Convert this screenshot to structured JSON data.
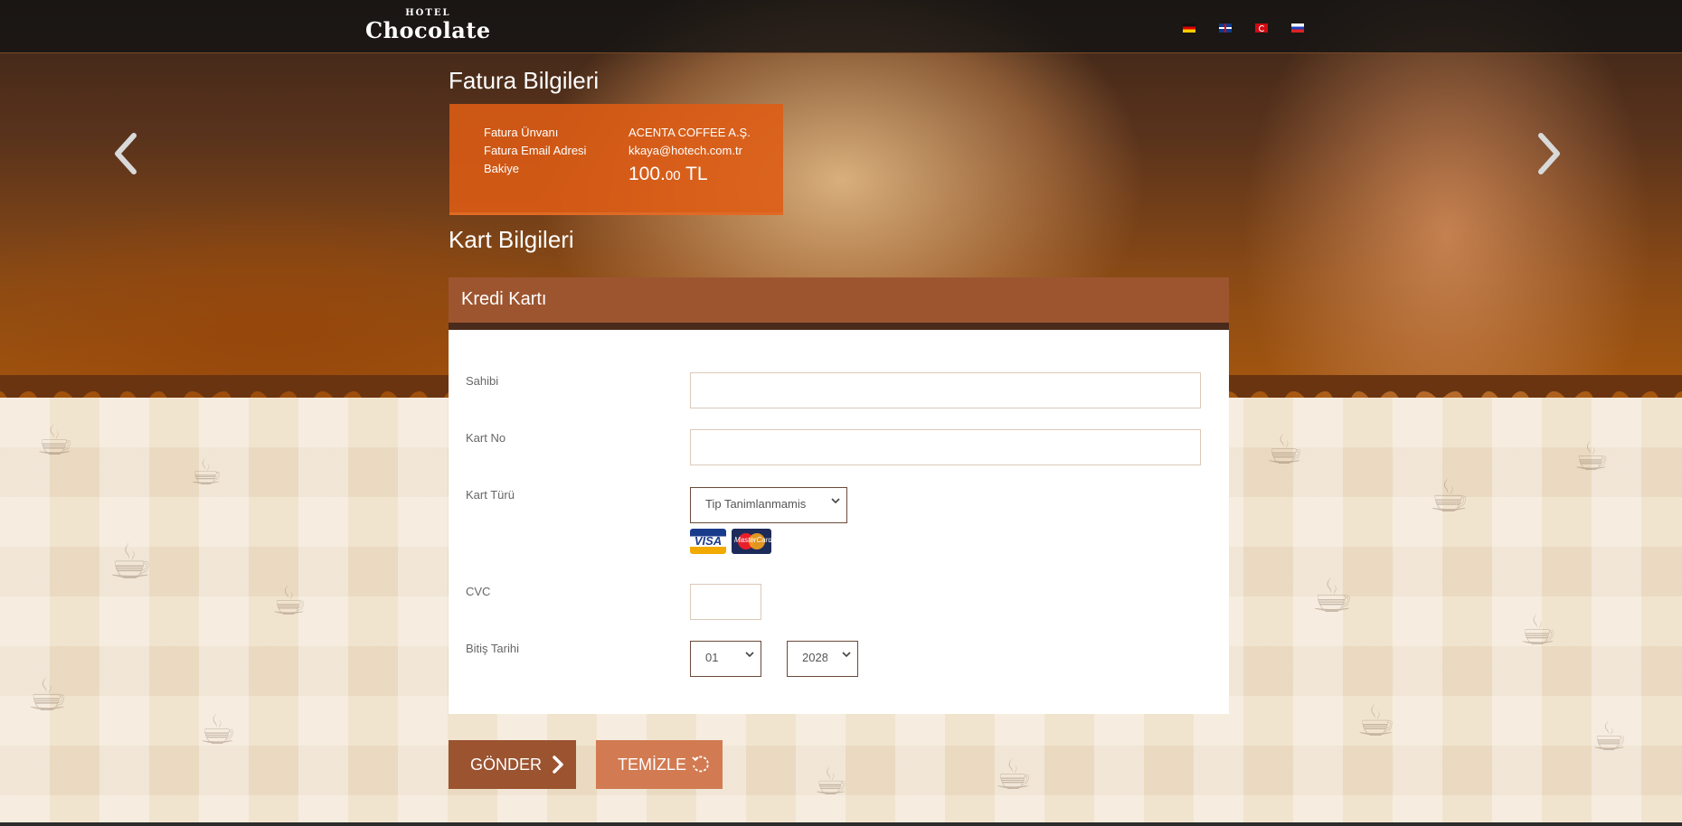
{
  "header": {
    "logo_small": "HOTEL",
    "logo_big": "Chocolate",
    "languages": [
      "de-flag-icon",
      "gb-flag-icon",
      "tr-flag-icon",
      "ru-flag-icon"
    ]
  },
  "invoice": {
    "title": "Fatura Bilgileri",
    "labels": {
      "title": "Fatura Ünvanı",
      "email": "Fatura Email Adresi",
      "balance": "Bakiye"
    },
    "values": {
      "title": "ACENTA COFFEE A.Ş.",
      "email": "kkaya@hotech.com.tr",
      "balance_int": "100.",
      "balance_dec": "00",
      "currency": " TL"
    }
  },
  "card": {
    "section_title": "Kart Bilgileri",
    "panel_title": "Kredi Kartı",
    "labels": {
      "owner": "Sahibi",
      "number": "Kart No",
      "type": "Kart Türü",
      "cvc": "CVC",
      "expiry": "Bitiş Tarihi"
    },
    "owner_value": "",
    "number_value": "",
    "cvc_value": "",
    "type_selected": "Tip Tanimlanmamis",
    "expiry_month": "01",
    "expiry_year": "2028",
    "logos": {
      "visa": "VISA",
      "mastercard": "MasterCard"
    }
  },
  "buttons": {
    "send": "GÖNDER",
    "clear": "TEMİZLE"
  },
  "colors": {
    "accent": "#9b5330",
    "accent_light": "#d27a52",
    "invoice_bg": "#de5c14",
    "panel_head": "#9d5530"
  }
}
